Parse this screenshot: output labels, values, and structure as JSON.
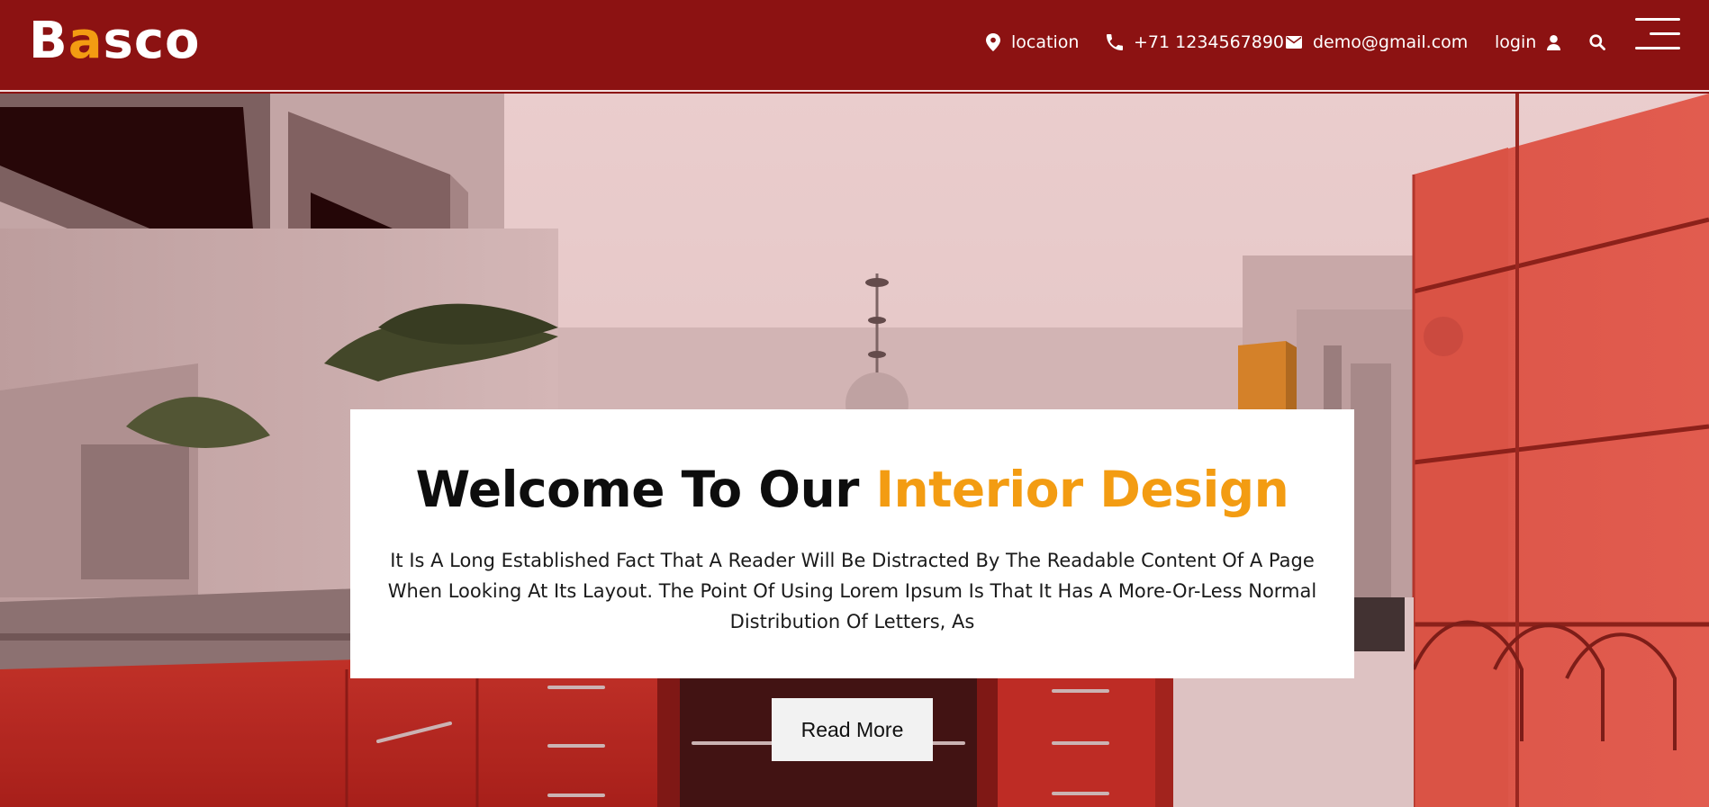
{
  "brand": {
    "logo_first": "B",
    "logo_accent": "a",
    "logo_rest": "sco",
    "accent_color": "#f39c12",
    "header_color": "#8c1212"
  },
  "topbar": {
    "location": {
      "label": "location",
      "icon": "map-pin-icon"
    },
    "phone": {
      "label": "+71 1234567890",
      "icon": "phone-icon"
    },
    "email": {
      "label": "demo@gmail.com",
      "icon": "envelope-icon"
    },
    "login": {
      "label": "login",
      "icon": "user-icon"
    },
    "search": {
      "icon": "search-icon"
    },
    "menu": {
      "icon": "menu-icon"
    }
  },
  "hero": {
    "title_main": "Welcome To Our ",
    "title_accent": "Interior Design",
    "description": "It Is A Long Established Fact That A Reader Will Be Distracted By The Readable Content Of A Page When Looking At Its Layout. The Point Of Using Lorem Ipsum Is That It Has A More-Or-Less Normal Distribution Of Letters, As",
    "cta_label": "Read More"
  }
}
